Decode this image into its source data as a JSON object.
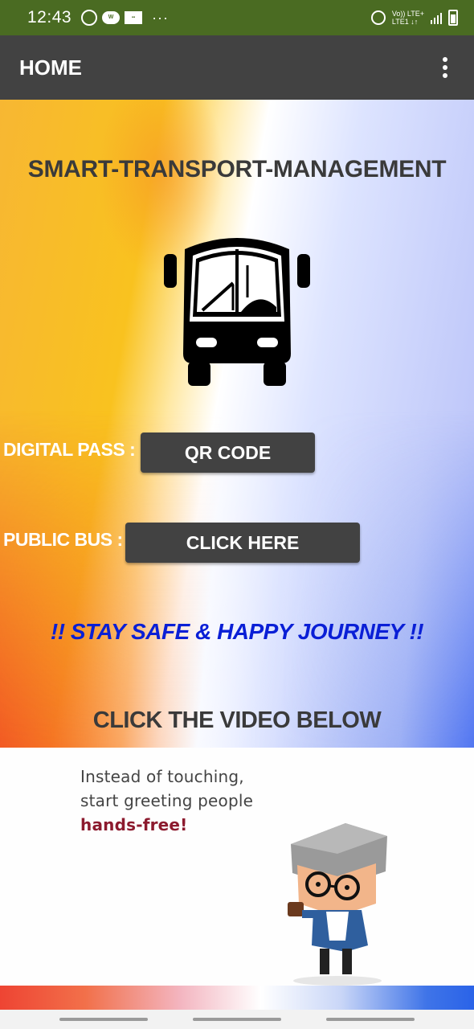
{
  "status_bar": {
    "time": "12:43",
    "icons": [
      "whatsapp-icon",
      "wear-icon",
      "notification-icon"
    ],
    "more": "···",
    "network_top": "Vo)) LTE+",
    "network_bottom": "LTE1 ↓↑",
    "background": "#4a6b22"
  },
  "app_bar": {
    "title": "HOME",
    "background": "#424242"
  },
  "main": {
    "title": "SMART-TRANSPORT-MANAGEMENT",
    "icon": "bus-icon",
    "digital_pass": {
      "label": "DIGITAL PASS :",
      "button": "QR CODE"
    },
    "public_bus": {
      "label": "PUBLIC BUS :",
      "button": "CLICK HERE"
    },
    "tagline": "!! STAY SAFE & HAPPY JOURNEY !!",
    "video_heading": "CLICK THE VIDEO BELOW"
  },
  "video": {
    "line1": "Instead of touching,",
    "line2": "start greeting people",
    "line3": "hands-free!"
  },
  "colors": {
    "button": "#424242",
    "tagline": "#0a1fd6",
    "heading": "#3a3a3a"
  }
}
